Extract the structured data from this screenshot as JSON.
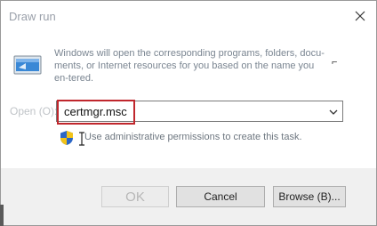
{
  "window": {
    "title": "Draw run"
  },
  "description": {
    "text": "Windows will open the corresponding programs, folders, docu-ments, or Internet resources for you based on the name you en-tered."
  },
  "open": {
    "label": "Open (O):",
    "value": "certmgr.msc"
  },
  "admin_note": "Use administrative permissions to create this task.",
  "buttons": {
    "ok": "OK",
    "cancel": "Cancel",
    "browse": "Browse (B)..."
  },
  "icons": {
    "close": "close-icon",
    "run": "run-app-icon",
    "shield": "uac-shield-icon",
    "dropdown": "chevron-down-icon"
  },
  "colors": {
    "highlight": "#c0272d",
    "footer": "#f0f0f0"
  }
}
